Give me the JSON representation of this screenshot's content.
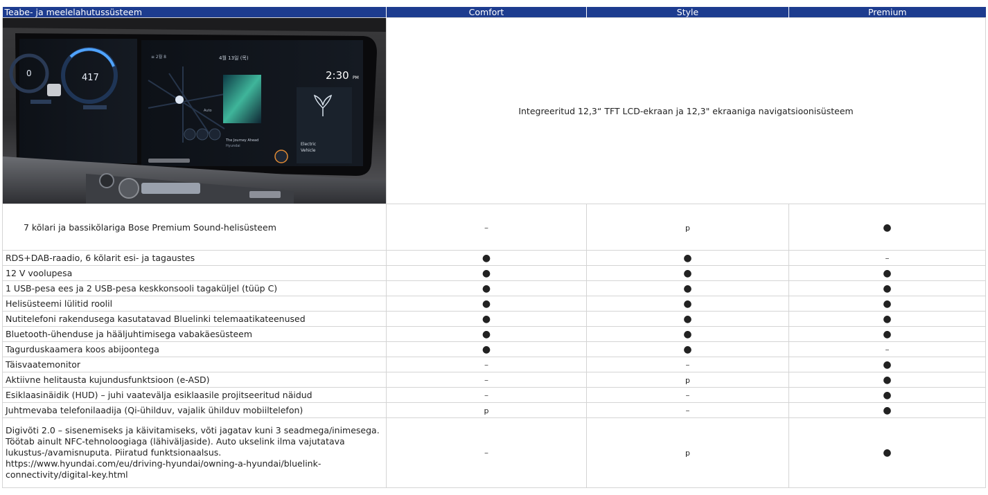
{
  "header": {
    "feature": "Teabe- ja meelelahutussüsteem",
    "trims": [
      "Comfort",
      "Style",
      "Premium"
    ]
  },
  "image_row": {
    "description_text": "Integreeritud 12,3“ TFT LCD-ekraan ja 12,3\" ekraaniga navigatsioonisüsteem",
    "screen": {
      "left_gauge_value": "0",
      "right_gauge_value": "417",
      "date": "4월 13일 (목)",
      "time": "2:30",
      "time_suffix": "PM",
      "nav_distance": "Auto",
      "media_title": "The Journey Ahead",
      "media_artist": "Hyundai",
      "ev_label_1": "Electric",
      "ev_label_2": "Vehicle"
    }
  },
  "rows": [
    {
      "label": "7 kõlari ja bassikõlariga Bose Premium Sound-helisüsteem",
      "values": [
        "–",
        "p",
        "●"
      ]
    },
    {
      "label": "RDS+DAB-raadio, 6 kõlarit esi- ja tagaustes",
      "values": [
        "●",
        "●",
        "–"
      ]
    },
    {
      "label": "12 V voolupesa",
      "values": [
        "●",
        "●",
        "●"
      ]
    },
    {
      "label": "1 USB-pesa ees ja 2 USB-pesa keskkonsooli tagaküljel (tüüp C)",
      "values": [
        "●",
        "●",
        "●"
      ]
    },
    {
      "label": "Helisüsteemi lülitid roolil",
      "values": [
        "●",
        "●",
        "●"
      ]
    },
    {
      "label": "Nutitelefoni rakendusega kasutatavad Bluelinki telemaatikateenused",
      "values": [
        "●",
        "●",
        "●"
      ]
    },
    {
      "label": "Bluetooth-ühenduse ja hääljuhtimisega vabakäesüsteem",
      "values": [
        "●",
        "●",
        "●"
      ]
    },
    {
      "label": "Tagurduskaamera koos abijoontega",
      "values": [
        "●",
        "●",
        "–"
      ]
    },
    {
      "label": "Täisvaatemonitor",
      "values": [
        "–",
        "–",
        "●"
      ]
    },
    {
      "label": "Aktiivne helitausta kujundusfunktsioon (e-ASD)",
      "values": [
        "–",
        "p",
        "●"
      ]
    },
    {
      "label": "Esiklaasinäidik (HUD) – juhi vaatevälja esiklaasile projitseeritud näidud",
      "values": [
        "–",
        "–",
        "●"
      ]
    },
    {
      "label": "Juhtmevaba telefonilaadija (Qi-ühilduv, vajalik ühilduv mobiiltelefon)",
      "values": [
        "p",
        "–",
        "●"
      ]
    },
    {
      "label": "Digivõti 2.0 – sisenemiseks ja käivitamiseks, võti jagatav kuni 3 seadmega/inimesega. Töötab ainult NFC-tehnoloogiaga (lähiväljaside). Auto ukselink ilma vajutatava lukustus-/avamisnuputa. Piiratud funktsionaalsus. https://www.hyundai.com/eu/driving-hyundai/owning-a-hyundai/bluelink-connectivity/digital-key.html",
      "values": [
        "–",
        "p",
        "●"
      ]
    }
  ]
}
